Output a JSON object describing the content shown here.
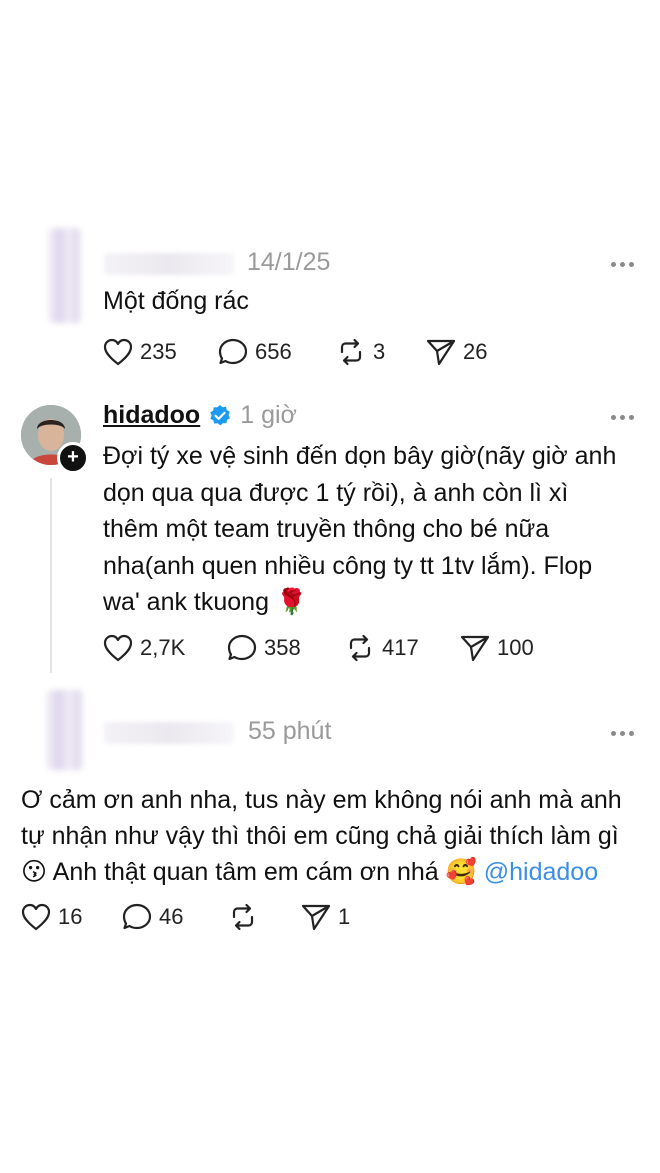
{
  "comment1": {
    "date": "14/1/25",
    "text": "Một đống rác",
    "likes": "235",
    "comments": "656",
    "reposts": "3",
    "shares": "26"
  },
  "reply": {
    "username": "hidadoo",
    "time": "1 giờ",
    "lines": [
      "Đợi tý xe vệ sinh đến dọn bây giờ(nãy giờ anh",
      "dọn qua qua được 1 tý rồi), à anh còn lì xì",
      "thêm một team truyền thông cho bé nữa",
      "nha(anh quen nhiều công ty tt 1tv lắm). Flop",
      "wa' ank tkuong"
    ],
    "emoji": "🌹",
    "likes": "2,7K",
    "comments": "358",
    "reposts": "417",
    "shares": "100"
  },
  "comment2": {
    "time": "55 phút",
    "line1": "Ơ cảm ơn anh nha, tus này em không nói anh mà anh",
    "line2": "tự nhận như vậy thì thôi em cũng chả giải thích làm gì",
    "emoji1": "😗",
    "line3": "Anh thật quan tâm em cám ơn nhá",
    "emoji2": "🥰",
    "mention": "@hidadoo",
    "likes": "16",
    "comments": "46",
    "shares": "1"
  },
  "colors": {
    "meta": "#9a9a9a",
    "mention": "#3b8ee6",
    "verified": "#1d9bf0"
  }
}
